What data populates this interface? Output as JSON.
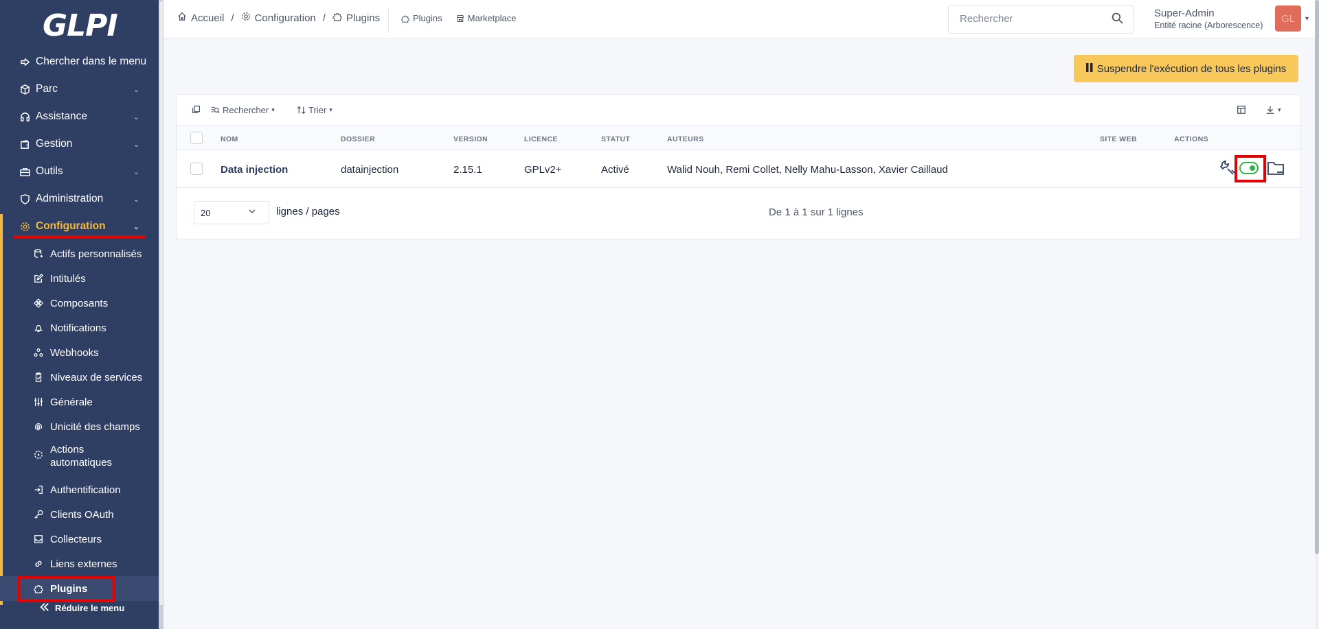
{
  "app": {
    "logo": "GLPI"
  },
  "sidebar": {
    "search_item": "Chercher dans le menu",
    "items": [
      {
        "label": "Parc"
      },
      {
        "label": "Assistance"
      },
      {
        "label": "Gestion"
      },
      {
        "label": "Outils"
      },
      {
        "label": "Administration"
      },
      {
        "label": "Configuration"
      }
    ],
    "subitems": [
      {
        "label": "Actifs personnalisés"
      },
      {
        "label": "Intitulés"
      },
      {
        "label": "Composants"
      },
      {
        "label": "Notifications"
      },
      {
        "label": "Webhooks"
      },
      {
        "label": "Niveaux de services"
      },
      {
        "label": "Générale"
      },
      {
        "label": "Unicité des champs"
      },
      {
        "label": "Actions automatiques"
      },
      {
        "label": "Authentification"
      },
      {
        "label": "Clients OAuth"
      },
      {
        "label": "Collecteurs"
      },
      {
        "label": "Liens externes"
      },
      {
        "label": "Plugins"
      }
    ],
    "reduce_label": "Réduire le menu",
    "accent_color": "#f5b83d",
    "background_color": "#2f3f64"
  },
  "header": {
    "breadcrumb": [
      "Accueil",
      "Configuration",
      "Plugins"
    ],
    "quick_links": [
      "Plugins",
      "Marketplace"
    ],
    "search_placeholder": "Rechercher",
    "user_name": "Super-Admin",
    "user_entity": "Entité racine (Arborescence)",
    "avatar_initials": "GL"
  },
  "main": {
    "suspend_button": "Suspendre l'exécution de tous les plugins",
    "toolbar": {
      "search_label": "Rechercher",
      "sort_label": "Trier"
    },
    "columns": [
      "NOM",
      "DOSSIER",
      "VERSION",
      "LICENCE",
      "STATUT",
      "AUTEURS",
      "SITE WEB",
      "ACTIONS"
    ],
    "rows": [
      {
        "name": "Data injection",
        "folder": "datainjection",
        "version": "2.15.1",
        "license": "GPLv2+",
        "status": "Activé",
        "authors": "Walid Nouh, Remi Collet, Nelly Mahu-Lasson, Xavier Caillaud",
        "website": ""
      }
    ],
    "pagination": {
      "page_size": "20",
      "page_size_label": "lignes / pages",
      "count_label": "De 1 à 1 sur 1 lignes"
    },
    "toggle_color": "#2fb344"
  }
}
